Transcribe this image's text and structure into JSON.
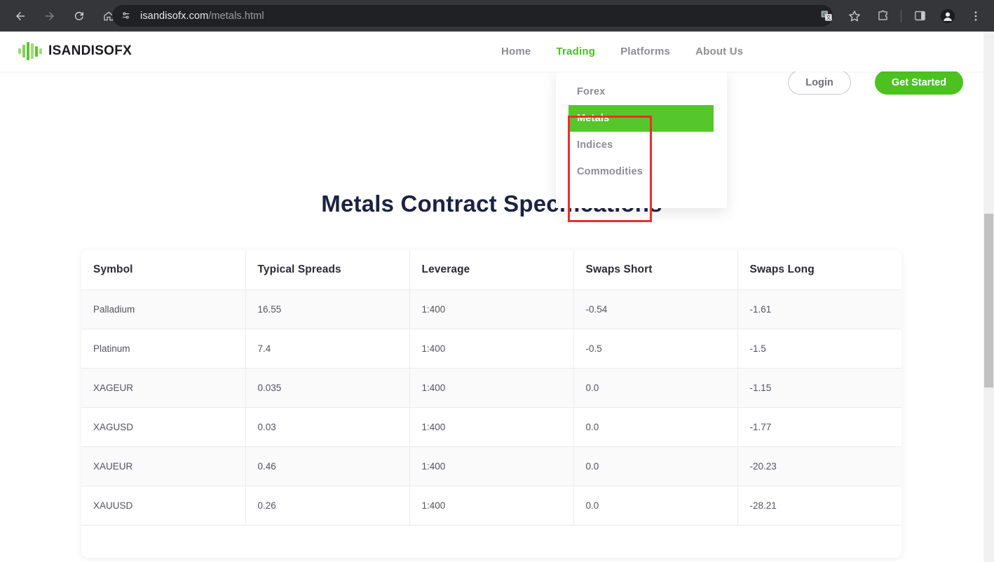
{
  "browser": {
    "back_icon": "back-arrow-icon",
    "forward_icon": "forward-arrow-icon",
    "reload_icon": "reload-icon",
    "home_icon": "home-icon",
    "site_info_icon": "page-settings-icon",
    "url_host": "isandisofx.com",
    "url_path": "/metals.html",
    "translate_icon": "translate-icon",
    "bookmark_icon": "star-icon",
    "extensions_icon": "extensions-puzzle-icon",
    "sidepanel_icon": "side-panel-icon",
    "profile_icon": "profile-avatar-icon",
    "menu_icon": "three-dot-menu-icon"
  },
  "site": {
    "brand": "ISANDISOFX",
    "logo_bars": [
      {
        "height": 8,
        "color": "#9BDB7E"
      },
      {
        "height": 18,
        "color": "#7FD15A"
      },
      {
        "height": 26,
        "color": "#5DC62F"
      },
      {
        "height": 22,
        "color": "#9BDB7E"
      },
      {
        "height": 15,
        "color": "#5DC62F"
      },
      {
        "height": 8,
        "color": "#9BDB7E"
      }
    ],
    "nav": [
      {
        "label": "Home",
        "active": false
      },
      {
        "label": "Trading",
        "active": true
      },
      {
        "label": "Platforms",
        "active": false
      },
      {
        "label": "About Us",
        "active": false
      }
    ],
    "login_label": "Login",
    "get_started_label": "Get Started",
    "accent_green": "#4CC21F",
    "highlight_green": "#55C62B",
    "annotation_color": "#F32A2A"
  },
  "dropdown": {
    "open": true,
    "items": [
      {
        "label": "Forex",
        "highlighted": false
      },
      {
        "label": "Metals",
        "highlighted": true
      },
      {
        "label": "Indices",
        "highlighted": false
      },
      {
        "label": "Commodities",
        "highlighted": false
      }
    ]
  },
  "main": {
    "title": "Metals Contract Specifications"
  },
  "table": {
    "columns": [
      "Symbol",
      "Typical Spreads",
      "Leverage",
      "Swaps Short",
      "Swaps Long"
    ],
    "rows": [
      [
        "Palladium",
        "16.55",
        "1:400",
        "-0.54",
        "-1.61"
      ],
      [
        "Platinum",
        "7.4",
        "1:400",
        "-0.5",
        "-1.5"
      ],
      [
        "XAGEUR",
        "0.035",
        "1:400",
        "0.0",
        "-1.15"
      ],
      [
        "XAGUSD",
        "0.03",
        "1:400",
        "0.0",
        "-1.77"
      ],
      [
        "XAUEUR",
        "0.46",
        "1:400",
        "0.0",
        "-20.23"
      ],
      [
        "XAUUSD",
        "0.26",
        "1:400",
        "0.0",
        "-28.21"
      ]
    ]
  }
}
